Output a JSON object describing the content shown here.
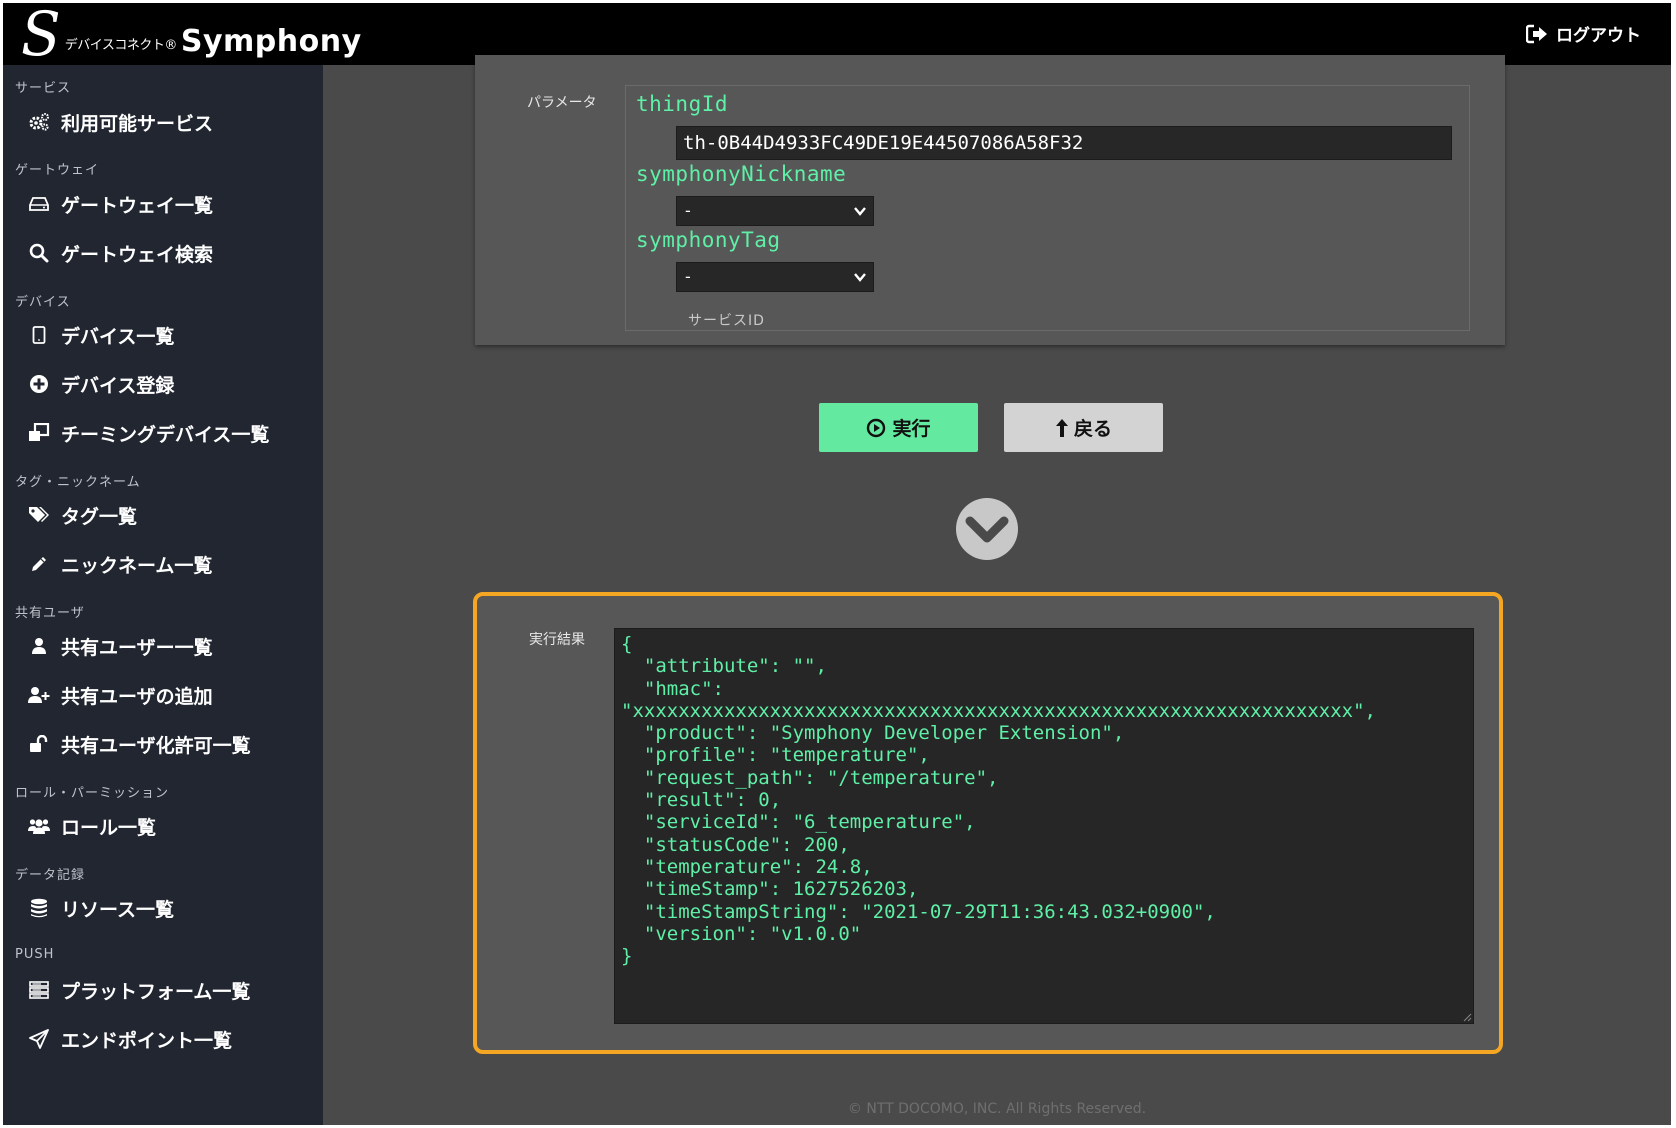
{
  "header": {
    "logo_sub": "デバイスコネクト®",
    "logo_name": "Symphony",
    "logout_label": "ログアウト"
  },
  "sidebar": {
    "sections": [
      {
        "title": "サービス",
        "items": [
          {
            "label": "利用可能サービス",
            "icon": "gears-icon"
          }
        ]
      },
      {
        "title": "ゲートウェイ",
        "items": [
          {
            "label": "ゲートウェイ一覧",
            "icon": "hdd-icon"
          },
          {
            "label": "ゲートウェイ検索",
            "icon": "search-icon"
          }
        ]
      },
      {
        "title": "デバイス",
        "items": [
          {
            "label": "デバイス一覧",
            "icon": "tablet-icon"
          },
          {
            "label": "デバイス登録",
            "icon": "plus-circle-icon"
          },
          {
            "label": "チーミングデバイス一覧",
            "icon": "clone-icon"
          }
        ]
      },
      {
        "title": "タグ・ニックネーム",
        "items": [
          {
            "label": "タグ一覧",
            "icon": "tags-icon"
          },
          {
            "label": "ニックネーム一覧",
            "icon": "pencil-icon"
          }
        ]
      },
      {
        "title": "共有ユーザ",
        "items": [
          {
            "label": "共有ユーザー一覧",
            "icon": "user-icon"
          },
          {
            "label": "共有ユーザの追加",
            "icon": "user-plus-icon"
          },
          {
            "label": "共有ユーザ化許可一覧",
            "icon": "unlock-icon"
          }
        ]
      },
      {
        "title": "ロール・パーミッション",
        "items": [
          {
            "label": "ロール一覧",
            "icon": "users-icon"
          }
        ]
      },
      {
        "title": "データ記録",
        "items": [
          {
            "label": "リソース一覧",
            "icon": "database-icon"
          }
        ]
      },
      {
        "title": "PUSH",
        "items": [
          {
            "label": "プラットフォーム一覧",
            "icon": "server-icon"
          },
          {
            "label": "エンドポイント一覧",
            "icon": "paper-plane-icon"
          }
        ]
      }
    ]
  },
  "params": {
    "label": "パラメータ",
    "thing_id": {
      "name": "thingId",
      "value": "th-0B44D4933FC49DE19E44507086A58F32"
    },
    "nickname": {
      "name": "symphonyNickname",
      "selected": "-"
    },
    "tag": {
      "name": "symphonyTag",
      "selected": "-"
    },
    "service_id_label": "サービスID"
  },
  "actions": {
    "run_label": "実行",
    "back_label": "戻る"
  },
  "result": {
    "label": "実行結果",
    "text": "{\n  \"attribute\": \"\",\n  \"hmac\":\n\"xxxxxxxxxxxxxxxxxxxxxxxxxxxxxxxxxxxxxxxxxxxxxxxxxxxxxxxxxxxxxxx\",\n  \"product\": \"Symphony Developer Extension\",\n  \"profile\": \"temperature\",\n  \"request_path\": \"/temperature\",\n  \"result\": 0,\n  \"serviceId\": \"6_temperature\",\n  \"statusCode\": 200,\n  \"temperature\": 24.8,\n  \"timeStamp\": 1627526203,\n  \"timeStampString\": \"2021-07-29T11:36:43.032+0900\",\n  \"version\": \"v1.0.0\"\n}"
  },
  "footer": {
    "copyright": "© NTT DOCOMO, INC. All Rights Reserved."
  },
  "colors": {
    "accent_green": "#63eaa0",
    "code_green": "#5ff0a7",
    "highlight_orange": "#f5a623",
    "sidebar_bg": "#212631"
  }
}
